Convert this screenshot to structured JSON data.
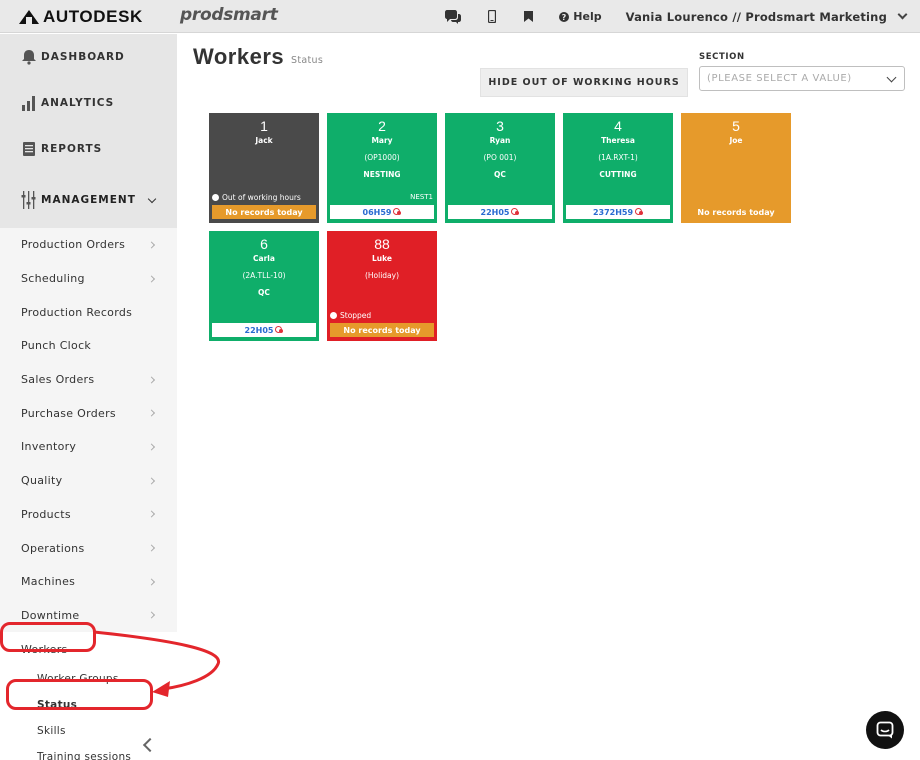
{
  "topbar": {
    "brand": "AUTODESK",
    "product": "prodsmart",
    "help_label": "Help",
    "user_label": "Vania Lourenco // Prodsmart Marketing",
    "icons": [
      "chat-icon",
      "mobile-icon",
      "bookmark-icon",
      "question-icon"
    ]
  },
  "sidebar": {
    "top_items": [
      {
        "label": "DASHBOARD",
        "icon": "bell-icon"
      },
      {
        "label": "ANALYTICS",
        "icon": "bar-chart-icon"
      },
      {
        "label": "REPORTS",
        "icon": "document-icon"
      }
    ],
    "management_label": "MANAGEMENT",
    "items": [
      {
        "label": "Production Orders"
      },
      {
        "label": "Scheduling"
      },
      {
        "label": "Production Records"
      },
      {
        "label": "Punch Clock"
      },
      {
        "label": "Sales Orders"
      },
      {
        "label": "Purchase Orders"
      },
      {
        "label": "Inventory"
      },
      {
        "label": "Quality"
      },
      {
        "label": "Products"
      },
      {
        "label": "Operations"
      },
      {
        "label": "Machines"
      },
      {
        "label": "Downtime"
      },
      {
        "label": "Workers"
      }
    ],
    "sub_items": [
      {
        "label": "Worker Groups"
      },
      {
        "label": "Status"
      },
      {
        "label": "Skills"
      },
      {
        "label": "Training sessions"
      }
    ]
  },
  "main": {
    "title": "Workers",
    "subtitle": "Status",
    "hide_button": "HIDE OUT OF WORKING HOURS",
    "section_label": "SECTION",
    "section_placeholder": "(PLEASE SELECT A VALUE)"
  },
  "workers": [
    {
      "num": "1",
      "name": "Jack",
      "status": "Out of working hours",
      "footer": "No records today",
      "color": "#4a4a4a"
    },
    {
      "num": "2",
      "name": "Mary",
      "order": "(OP1000)",
      "operation": "NESTING",
      "machine": "NEST1",
      "footer": "06H59",
      "color": "#0fae6a"
    },
    {
      "num": "3",
      "name": "Ryan",
      "order": "(PO 001)",
      "operation": "QC",
      "footer": "22H05",
      "color": "#0fae6a"
    },
    {
      "num": "4",
      "name": "Theresa",
      "order": "(1A.RXT-1)",
      "operation": "CUTTING",
      "footer": "2372H59",
      "color": "#0fae6a"
    },
    {
      "num": "5",
      "name": "Joe",
      "footer": "No records today",
      "color": "#e69a2b"
    },
    {
      "num": "6",
      "name": "Carla",
      "order": "(2A.TLL-10)",
      "operation": "QC",
      "footer": "22H05",
      "color": "#0fae6a"
    },
    {
      "num": "88",
      "name": "Luke",
      "order": "(Holiday)",
      "status": "Stopped",
      "footer": "No records today",
      "color": "#e01f26"
    }
  ]
}
